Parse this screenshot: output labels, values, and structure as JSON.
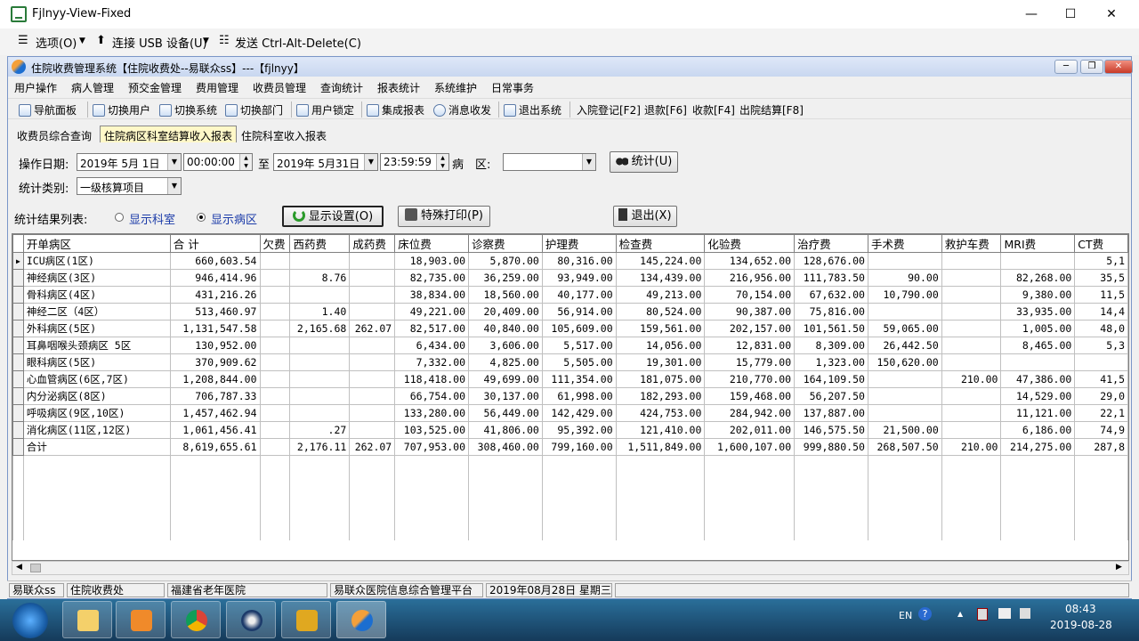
{
  "vm": {
    "title": "Fjlnyy-View-Fixed",
    "menu": [
      "选项(O)",
      "连接 USB 设备(U)",
      "发送 Ctrl-Alt-Delete(C)"
    ]
  },
  "app": {
    "title": "住院收费管理系统【住院收费处--易联众ss】---【fjlnyy】",
    "menus": [
      "用户操作",
      "病人管理",
      "预交金管理",
      "费用管理",
      "收费员管理",
      "查询统计",
      "报表统计",
      "系统维护",
      "日常事务"
    ],
    "toolbar": [
      "导航面板",
      "切换用户",
      "切换系统",
      "切换部门",
      "用户锁定",
      "集成报表",
      "消息收发",
      "退出系统",
      "入院登记[F2]",
      "退款[F6]",
      "收款[F4]",
      "出院结算[F8]"
    ],
    "tabs": [
      "收费员综合查询",
      "住院病区科室结算收入报表",
      "住院科室收入报表"
    ]
  },
  "form": {
    "date_label": "操作日期:",
    "date_from": "2019年 5月 1日",
    "time_from": "00:00:00",
    "to_label": "至",
    "date_to": "2019年 5月31日",
    "time_to": "23:59:59",
    "ward_label": "病　区:",
    "ward_value": "",
    "stat_button": "统计(U)",
    "category_label": "统计类别:",
    "category_value": "一级核算项目",
    "result_label": "统计结果列表:",
    "radio_dept": "显示科室",
    "radio_ward": "显示病区",
    "display_settings": "显示设置(O)",
    "special_print": "特殊打印(P)",
    "exit": "退出(X)"
  },
  "grid": {
    "columns": [
      "开单病区",
      "合 计",
      "欠费",
      "西药费",
      "成药费",
      "床位费",
      "诊察费",
      "护理费",
      "检查费",
      "化验费",
      "治疗费",
      "手术费",
      "救护车费",
      "MRI费",
      "CT费"
    ],
    "rows": [
      [
        "ICU病区(1区)",
        "660,603.54",
        "",
        "",
        "",
        "18,903.00",
        "5,870.00",
        "80,316.00",
        "145,224.00",
        "134,652.00",
        "128,676.00",
        "",
        "",
        "",
        "5,1"
      ],
      [
        "神经病区(3区)",
        "946,414.96",
        "",
        "8.76",
        "",
        "82,735.00",
        "36,259.00",
        "93,949.00",
        "134,439.00",
        "216,956.00",
        "111,783.50",
        "90.00",
        "",
        "82,268.00",
        "35,5"
      ],
      [
        "骨科病区(4区)",
        "431,216.26",
        "",
        "",
        "",
        "38,834.00",
        "18,560.00",
        "40,177.00",
        "49,213.00",
        "70,154.00",
        "67,632.00",
        "10,790.00",
        "",
        "9,380.00",
        "11,5"
      ],
      [
        "神经二区（4区）",
        "513,460.97",
        "",
        "1.40",
        "",
        "49,221.00",
        "20,409.00",
        "56,914.00",
        "80,524.00",
        "90,387.00",
        "75,816.00",
        "",
        "",
        "33,935.00",
        "14,4"
      ],
      [
        "外科病区(5区)",
        "1,131,547.58",
        "",
        "2,165.68",
        "262.07",
        "82,517.00",
        "40,840.00",
        "105,609.00",
        "159,561.00",
        "202,157.00",
        "101,561.50",
        "59,065.00",
        "",
        "1,005.00",
        "48,0"
      ],
      [
        "耳鼻咽喉头颈病区 5区",
        "130,952.00",
        "",
        "",
        "",
        "6,434.00",
        "3,606.00",
        "5,517.00",
        "14,056.00",
        "12,831.00",
        "8,309.00",
        "26,442.50",
        "",
        "8,465.00",
        "5,3"
      ],
      [
        "眼科病区(5区)",
        "370,909.62",
        "",
        "",
        "",
        "7,332.00",
        "4,825.00",
        "5,505.00",
        "19,301.00",
        "15,779.00",
        "1,323.00",
        "150,620.00",
        "",
        "",
        ""
      ],
      [
        "心血管病区(6区,7区)",
        "1,208,844.00",
        "",
        "",
        "",
        "118,418.00",
        "49,699.00",
        "111,354.00",
        "181,075.00",
        "210,770.00",
        "164,109.50",
        "",
        "210.00",
        "47,386.00",
        "41,5"
      ],
      [
        "内分泌病区(8区)",
        "706,787.33",
        "",
        "",
        "",
        "66,754.00",
        "30,137.00",
        "61,998.00",
        "182,293.00",
        "159,468.00",
        "56,207.50",
        "",
        "",
        "14,529.00",
        "29,0"
      ],
      [
        "呼吸病区(9区,10区)",
        "1,457,462.94",
        "",
        "",
        "",
        "133,280.00",
        "56,449.00",
        "142,429.00",
        "424,753.00",
        "284,942.00",
        "137,887.00",
        "",
        "",
        "11,121.00",
        "22,1"
      ],
      [
        "消化病区(11区,12区)",
        "1,061,456.41",
        "",
        ".27",
        "",
        "103,525.00",
        "41,806.00",
        "95,392.00",
        "121,410.00",
        "202,011.00",
        "146,575.50",
        "21,500.00",
        "",
        "6,186.00",
        "74,9"
      ],
      [
        "合计",
        "8,619,655.61",
        "",
        "2,176.11",
        "262.07",
        "707,953.00",
        "308,460.00",
        "799,160.00",
        "1,511,849.00",
        "1,600,107.00",
        "999,880.50",
        "268,507.50",
        "210.00",
        "214,275.00",
        "287,8"
      ]
    ]
  },
  "status": [
    "易联众ss",
    "住院收费处",
    "福建省老年医院",
    "易联众医院信息综合管理平台",
    "2019年08月28日 星期三"
  ],
  "taskbar": {
    "lang": "EN",
    "time": "08:43",
    "date": "2019-08-28"
  }
}
